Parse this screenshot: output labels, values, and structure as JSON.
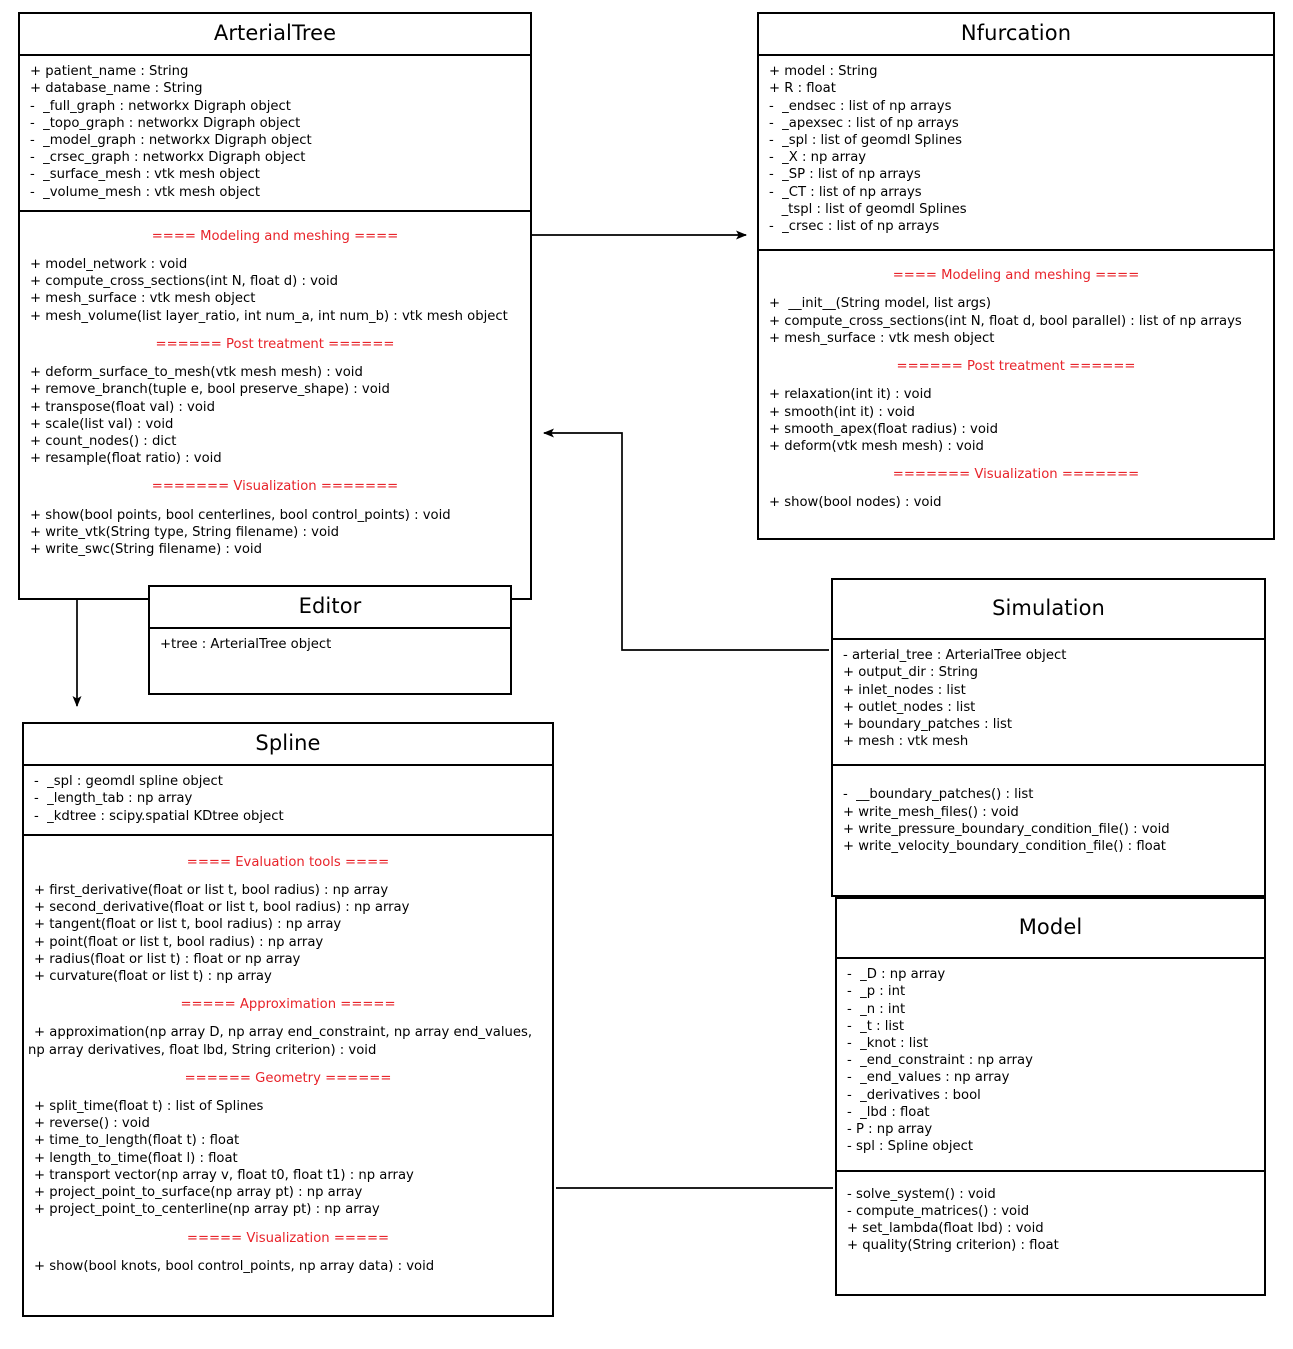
{
  "diagram": {
    "kind": "uml-class-diagram",
    "accent_red": "#e8232a",
    "line_color": "#000000",
    "background": "#ffffff"
  },
  "classes": {
    "arterial_tree": {
      "name": "ArterialTree",
      "attributes": [
        "+ patient_name : String",
        "+ database_name : String",
        "-  _full_graph : networkx Digraph object",
        "-  _topo_graph : networkx Digraph object",
        "-  _model_graph : networkx Digraph object",
        "-  _crsec_graph : networkx Digraph object",
        "-  _surface_mesh : vtk mesh object",
        "-  _volume_mesh : vtk mesh object"
      ],
      "sections": [
        {
          "header": "====  Modeling and meshing  ====",
          "methods": [
            "+ model_network : void",
            "+ compute_cross_sections(int N, float d) : void",
            "+ mesh_surface : vtk mesh object",
            "+ mesh_volume(list layer_ratio, int num_a, int num_b) : vtk mesh object"
          ]
        },
        {
          "header": "======  Post treatment  ======",
          "methods": [
            "+ deform_surface_to_mesh(vtk mesh mesh) : void",
            "+ remove_branch(tuple e, bool preserve_shape) : void",
            "+ transpose(float val) : void",
            "+ scale(list val) : void",
            "+ count_nodes() : dict",
            "+ resample(float ratio) : void"
          ]
        },
        {
          "header": "=======  Visualization  =======",
          "methods": [
            "+ show(bool points, bool centerlines, bool control_points) : void",
            "+ write_vtk(String type, String filename) : void",
            "+ write_swc(String filename) : void"
          ]
        }
      ]
    },
    "nfurcation": {
      "name": "Nfurcation",
      "attributes": [
        "+ model : String",
        "+ R : float",
        "-  _endsec : list of np arrays",
        "-  _apexsec : list of np arrays",
        "-  _spl : list of geomdl Splines",
        "-  _X : np array",
        "-  _SP : list of np arrays",
        "-  _CT : list of np arrays",
        "   _tspl : list of geomdl Splines",
        "-  _crsec : list of np arrays"
      ],
      "sections": [
        {
          "header": "====  Modeling and meshing  ====",
          "methods": [
            "+  __init__(String model, list args)",
            "+ compute_cross_sections(int N, float d, bool parallel) : list of np arrays",
            "+ mesh_surface : vtk mesh object"
          ]
        },
        {
          "header": "======  Post treatment  ======",
          "methods": [
            "+ relaxation(int it) : void",
            "+ smooth(int it) : void",
            "+ smooth_apex(float radius) : void",
            "+ deform(vtk mesh mesh) : void"
          ]
        },
        {
          "header": "=======  Visualization  =======",
          "methods": [
            "+ show(bool nodes) : void"
          ]
        }
      ]
    },
    "editor": {
      "name": "Editor",
      "attributes": [
        "+tree : ArterialTree object"
      ],
      "sections": []
    },
    "spline": {
      "name": "Spline",
      "attributes": [
        "-  _spl : geomdl spline object",
        "-  _length_tab : np array",
        "-  _kdtree : scipy.spatial KDtree object"
      ],
      "sections": [
        {
          "header": "====  Evaluation tools  ====",
          "methods": [
            "+ first_derivative(float or list t, bool radius) : np array",
            "+ second_derivative(float or list t, bool radius) : np array",
            "+ tangent(float or list t, bool radius) : np array",
            "+ point(float or list t, bool radius) : np array",
            "+ radius(float or list t) : float or np array",
            "+ curvature(float or list t) : np array"
          ]
        },
        {
          "header": "=====  Approximation  =====",
          "methods": [
            "+ approximation(np array D, np array end_constraint, np array end_values, np array derivatives, float lbd, String criterion) : void"
          ]
        },
        {
          "header": "======  Geometry  ======",
          "methods": [
            "+ split_time(float t) : list of Splines",
            "+ reverse() : void",
            "+ time_to_length(float t) : float",
            "+ length_to_time(float l) : float",
            "+ transport vector(np array v, float t0, float t1) : np array",
            "+ project_point_to_surface(np array pt) : np array",
            "+ project_point_to_centerline(np array pt) : np array"
          ]
        },
        {
          "header": "=====  Visualization  =====",
          "methods": [
            "+ show(bool knots, bool control_points, np array data) : void"
          ]
        }
      ]
    },
    "simulation": {
      "name": "Simulation",
      "attributes": [
        "- arterial_tree : ArterialTree object",
        "+ output_dir : String",
        "+ inlet_nodes : list",
        "+ outlet_nodes : list",
        "+ boundary_patches : list",
        "+ mesh : vtk mesh"
      ],
      "sections": [
        {
          "header": "",
          "methods": [
            "-  __boundary_patches() : list",
            "+ write_mesh_files() : void",
            "+ write_pressure_boundary_condition_file() : void",
            "+ write_velocity_boundary_condition_file() : float"
          ]
        }
      ]
    },
    "model": {
      "name": "Model",
      "attributes": [
        "-  _D : np array",
        "-  _p : int",
        "-  _n : int",
        "-  _t : list",
        "-  _knot : list",
        "-  _end_constraint : np array",
        "-  _end_values : np array",
        "-  _derivatives : bool",
        "-  _lbd : float",
        "- P : np array",
        "- spl : Spline object"
      ],
      "sections": [
        {
          "header": "",
          "methods": [
            "- solve_system() : void",
            "- compute_matrices() : void",
            "+ set_lambda(float lbd) : void",
            "+ quality(String criterion) : float"
          ]
        }
      ]
    }
  },
  "connectors": [
    {
      "id": "arterialtree-to-nfurcation",
      "style": "arrow-right"
    },
    {
      "id": "simulation-to-arterialtree",
      "style": "elbow-arrow-left"
    },
    {
      "id": "arterialtree-to-spline",
      "style": "arrow-down"
    },
    {
      "id": "editor-to-arterialtree",
      "style": "arrow-up"
    },
    {
      "id": "spline-to-model",
      "style": "plain-line"
    }
  ]
}
